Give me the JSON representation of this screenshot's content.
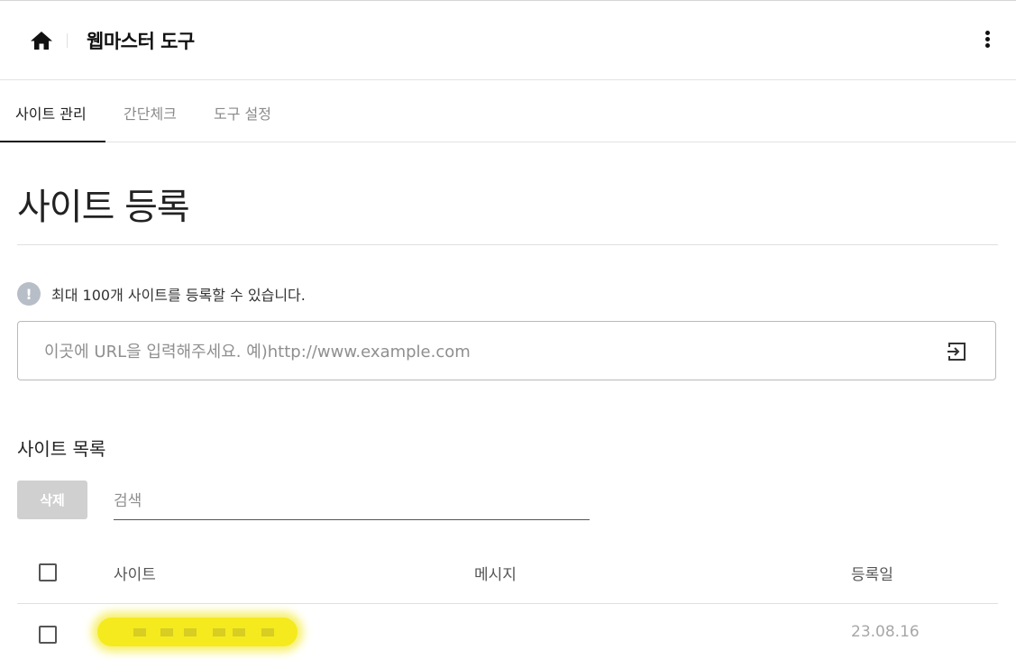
{
  "header": {
    "title": "웹마스터 도구",
    "home_icon": "home-icon",
    "more_icon": "more-vertical-icon"
  },
  "tabs": [
    {
      "label": "사이트 관리",
      "active": true
    },
    {
      "label": "간단체크",
      "active": false
    },
    {
      "label": "도구 설정",
      "active": false
    }
  ],
  "main": {
    "page_title": "사이트 등록",
    "notice": {
      "icon": "!",
      "text": "최대 100개 사이트를 등록할 수 있습니다."
    },
    "url_input": {
      "placeholder": "이곳에 URL을 입력해주세요. 예)http://www.example.com",
      "value": "",
      "submit_icon": "enter-icon"
    },
    "site_list": {
      "title": "사이트 목록",
      "delete_label": "삭제",
      "search_placeholder": "검색",
      "columns": [
        "사이트",
        "메시지",
        "등록일"
      ],
      "rows": [
        {
          "site": "",
          "message": "",
          "date": "23.08.16",
          "checked": false
        }
      ]
    }
  },
  "colors": {
    "accent": "#111111",
    "disabled_button": "#d0d0d0",
    "highlight": "#f5ea1e"
  }
}
